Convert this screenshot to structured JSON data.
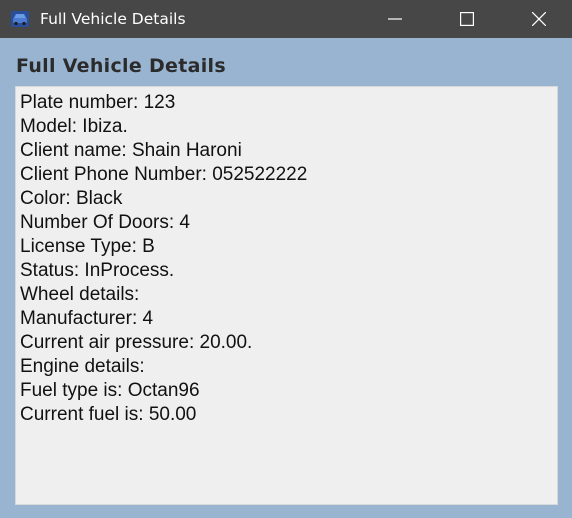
{
  "window": {
    "title": "Full Vehicle Details",
    "app_icon": "car-icon",
    "controls": {
      "minimize_icon": "minimize-icon",
      "maximize_icon": "maximize-icon",
      "close_icon": "close-icon"
    }
  },
  "heading": "Full Vehicle Details",
  "details": [
    "Plate number: 123",
    "Model: Ibiza.",
    "Client name: Shain Haroni",
    "Client Phone Number: 052522222",
    "Color: Black",
    "Number Of Doors: 4",
    "License Type: B",
    "Status: InProcess.",
    "Wheel details:",
    "Manufacturer: 4",
    "Current air pressure: 20.00.",
    "Engine details:",
    "Fuel type is: Octan96",
    "Current fuel is: 50.00"
  ],
  "colors": {
    "titlebar": "#474747",
    "window_background": "#99b4d1",
    "details_background": "#efefef"
  }
}
